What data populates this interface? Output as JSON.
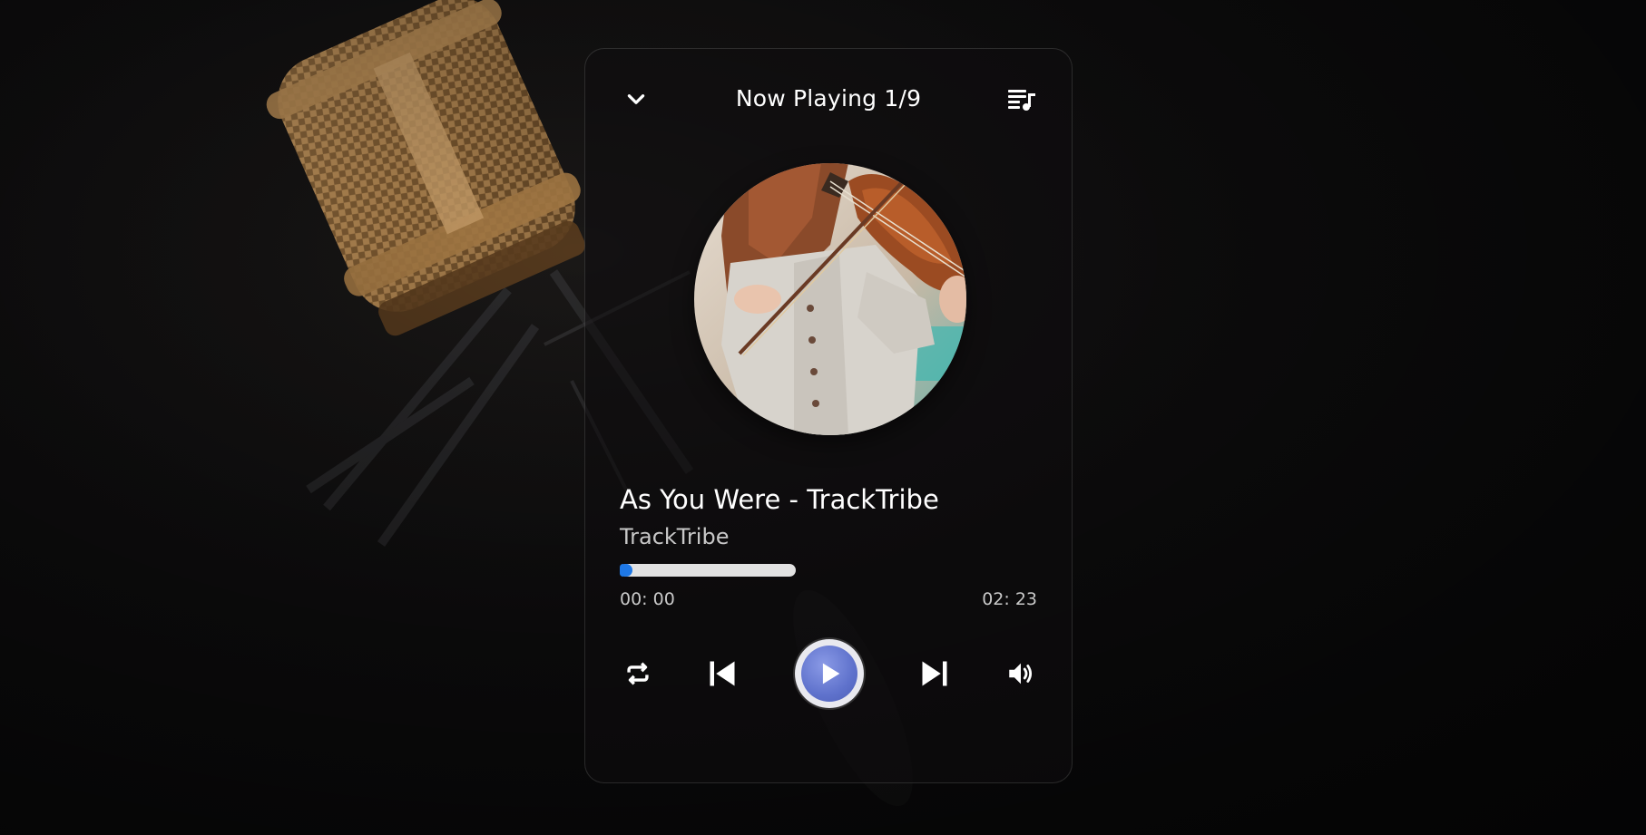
{
  "header": {
    "title": "Now Playing 1/9",
    "collapse_icon": "chevron-down-icon",
    "playlist_icon": "playlist-music-icon"
  },
  "track": {
    "title": "As You Were - TrackTribe",
    "artist": "TrackTribe",
    "artwork_description_icon": "album-artwork",
    "progress_fraction": 0.0,
    "current_time": "00: 00",
    "total_time": "02: 23"
  },
  "controls": {
    "repeat_icon": "repeat-icon",
    "previous_icon": "skip-previous-icon",
    "play_icon": "play-icon",
    "next_icon": "skip-next-icon",
    "volume_icon": "volume-icon"
  },
  "colors": {
    "accent": "#1e78e6",
    "play_button": "#5f72cc",
    "text_primary": "#ffffff",
    "text_secondary": "#c8c8c8"
  }
}
